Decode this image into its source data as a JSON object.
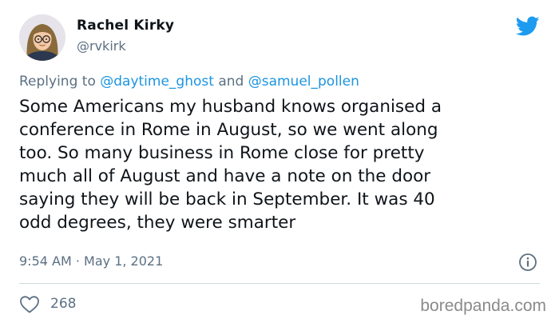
{
  "user": {
    "display_name": "Rachel Kirky",
    "handle": "@rvkirk"
  },
  "reply": {
    "prefix": "Replying to ",
    "mention_1": "@daytime_ghost",
    "conjunction": " and ",
    "mention_2": "@samuel_pollen"
  },
  "tweet": {
    "text": "Some Americans my husband knows organised a\nconference in Rome in August, so we went along\ntoo. So many business in Rome close for pretty\nmuch all of August and have a note on the door\nsaying they will be back in September. It was 40\nodd degrees, they were smarter",
    "timestamp": "9:54 AM · May 1, 2021"
  },
  "engagement": {
    "likes": "268"
  },
  "watermark": "boredpanda.com",
  "colors": {
    "twitter_blue": "#1d9bf0",
    "mention_blue": "#1b95e0",
    "secondary_text": "#5b7083",
    "divider": "#cfd9de"
  },
  "icons": {
    "brand": "twitter-bird-icon",
    "info": "info-icon",
    "like": "heart-icon"
  }
}
